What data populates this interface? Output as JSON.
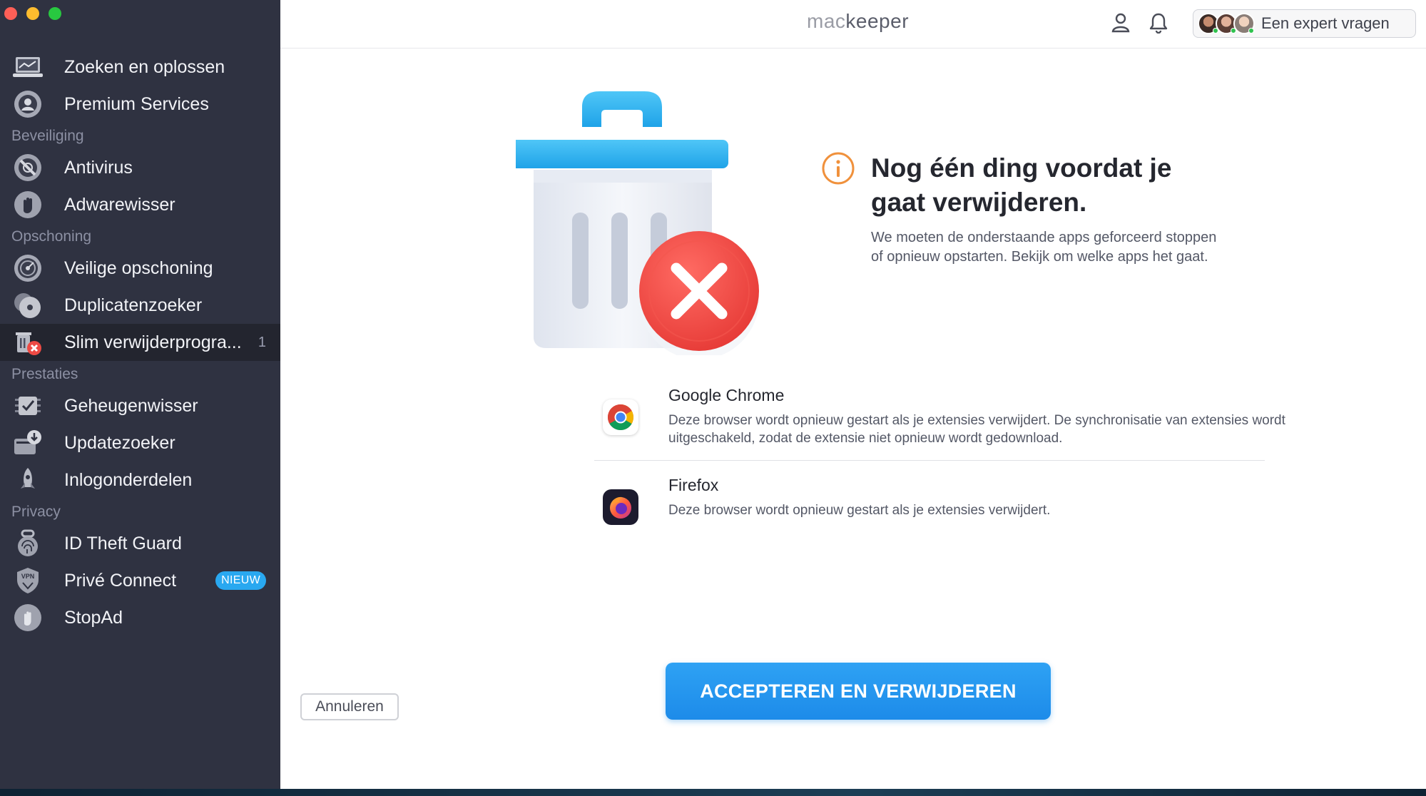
{
  "app": {
    "logo_mac": "mac",
    "logo_keeper": "keeper",
    "expert_button": "Een expert vragen"
  },
  "sidebar": {
    "items": [
      {
        "type": "item",
        "label": "Zoeken en oplossen",
        "icon": "laptop-scan-icon"
      },
      {
        "type": "item",
        "label": "Premium Services",
        "icon": "premium-support-icon"
      },
      {
        "type": "section",
        "label": "Beveiliging"
      },
      {
        "type": "item",
        "label": "Antivirus",
        "icon": "antivirus-icon"
      },
      {
        "type": "item",
        "label": "Adwarewisser",
        "icon": "hand-stop-icon"
      },
      {
        "type": "section",
        "label": "Opschoning"
      },
      {
        "type": "item",
        "label": "Veilige opschoning",
        "icon": "disk-clean-icon"
      },
      {
        "type": "item",
        "label": "Duplicatenzoeker",
        "icon": "duplicate-disks-icon"
      },
      {
        "type": "item",
        "label": "Slim verwijderprogra...",
        "icon": "smart-uninstaller-icon",
        "count": "1",
        "active": true
      },
      {
        "type": "section",
        "label": "Prestaties"
      },
      {
        "type": "item",
        "label": "Geheugenwisser",
        "icon": "memory-chip-icon"
      },
      {
        "type": "item",
        "label": "Updatezoeker",
        "icon": "update-download-icon"
      },
      {
        "type": "item",
        "label": "Inlogonderdelen",
        "icon": "rocket-icon"
      },
      {
        "type": "section",
        "label": "Privacy"
      },
      {
        "type": "item",
        "label": "ID Theft Guard",
        "icon": "fingerprint-icon"
      },
      {
        "type": "item",
        "label": "Privé Connect",
        "icon": "vpn-shield-icon",
        "badge": "NIEUW"
      },
      {
        "type": "item",
        "label": "StopAd",
        "icon": "stop-hand-icon"
      }
    ]
  },
  "dialog": {
    "title": "Nog één ding voordat je gaat verwijderen.",
    "subtitle": "We moeten de onderstaande apps geforceerd stoppen of opnieuw opstarten. Bekijk om welke apps het gaat.",
    "apps": [
      {
        "name": "Google Chrome",
        "desc": "Deze browser wordt opnieuw gestart als je extensies verwijdert. De synchronisatie van extensies wordt uitgeschakeld, zodat de extensie niet opnieuw wordt gedownload.",
        "icon": "chrome-icon"
      },
      {
        "name": "Firefox",
        "desc": "Deze browser wordt opnieuw gestart als je extensies verwijdert.",
        "icon": "firefox-icon"
      }
    ],
    "accept_button": "ACCEPTEREN EN VERWIJDEREN",
    "cancel_button": "Annuleren"
  },
  "colors": {
    "sidebar_bg": "#2f3241",
    "accent": "#1d8be9",
    "badge": "#29a8f0",
    "info": "#f0913c",
    "danger": "#ee4a44"
  }
}
